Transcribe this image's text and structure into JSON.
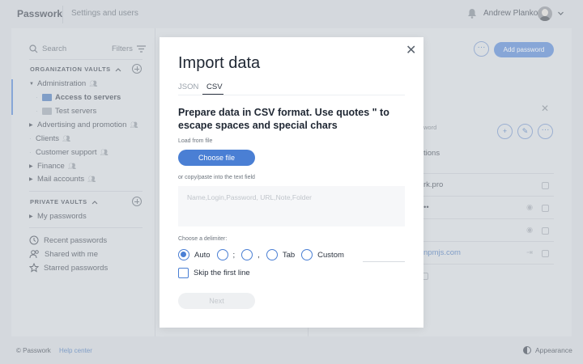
{
  "topbar": {
    "logo": "Passwork",
    "section": "Settings and users",
    "user": "Andrew Plankov"
  },
  "sidebar": {
    "search_label": "Search",
    "filters_label": "Filters",
    "org_vaults_heading": "ORGANIZATION VAULTS",
    "private_vaults_heading": "PRIVATE VAULTS",
    "tree": [
      {
        "label": "Administration"
      },
      {
        "label": "Access to servers"
      },
      {
        "label": "Test servers"
      },
      {
        "label": "Advertising and promotion"
      },
      {
        "label": "Clients"
      },
      {
        "label": "Customer support"
      },
      {
        "label": "Finance"
      },
      {
        "label": "Mail accounts"
      }
    ],
    "private_tree": [
      {
        "label": "My passwords"
      }
    ],
    "bottom_links": [
      {
        "label": "Recent passwords",
        "icon": "clock-icon"
      },
      {
        "label": "Shared with me",
        "icon": "users-icon"
      },
      {
        "label": "Starred passwords",
        "icon": "star-icon"
      }
    ]
  },
  "background": {
    "add_password_label": "Add password",
    "ellipsis": "···",
    "partial_texts": {
      "word": "word",
      "tions": "tions",
      "url": "rk.pro",
      "dots": "••",
      "email": "npmjs.com"
    }
  },
  "footer": {
    "copyright": "© Passwork",
    "help": "Help center",
    "appearance": "Appearance"
  },
  "modal": {
    "title": "Import data",
    "close": "✕",
    "tabs": [
      {
        "label": "JSON",
        "active": false
      },
      {
        "label": "CSV",
        "active": true
      }
    ],
    "heading": "Prepare data in CSV format. Use quotes \" to escape spaces and special chars",
    "load_label": "Load from file",
    "choose_file": "Choose file",
    "paste_label": "or copy/paste into the text field",
    "textarea_placeholder": "Name,Login,Password, URL,Note,Folder",
    "delimiter_label": "Choose a delimiter:",
    "delimiters": [
      {
        "label": "Auto",
        "selected": true
      },
      {
        "label": ";",
        "selected": false
      },
      {
        "label": ",",
        "selected": false
      },
      {
        "label": "Tab",
        "selected": false
      },
      {
        "label": "Custom",
        "selected": false
      }
    ],
    "skip_first_line": "Skip the first line",
    "next": "Next"
  },
  "colors": {
    "accent": "#4a7fd4",
    "background": "#d5d9de"
  }
}
